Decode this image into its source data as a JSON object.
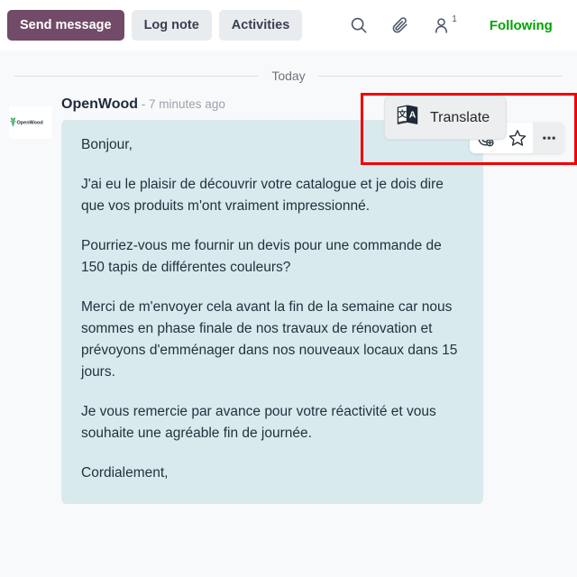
{
  "toolbar": {
    "send_message_label": "Send message",
    "log_note_label": "Log note",
    "activities_label": "Activities",
    "search_icon": "search-icon",
    "attachment_icon": "paperclip-icon",
    "followers_icon": "user-icon",
    "followers_count": "1",
    "following_label": "Following",
    "following_color": "#00a400",
    "send_button_color": "#714b67"
  },
  "thread": {
    "date_separator": "Today",
    "message": {
      "author": "OpenWood",
      "author_separator": " - ",
      "timestamp": "7 minutes ago",
      "avatar_alt": "OpenWood",
      "bubble_color": "#d9eaef",
      "paragraphs": [
        "Bonjour,",
        "J'ai eu le plaisir de découvrir votre catalogue et je dois dire que vos produits m'ont vraiment impressionné.",
        "Pourriez-vous me fournir un devis pour une commande de 150 tapis de différentes couleurs?",
        "Merci de m'envoyer cela avant la fin de la semaine car nous sommes en phase finale de nos travaux de rénovation et prévoyons d'emménager dans nos nouveaux locaux dans 15 jours.",
        "Je vous remercie par avance pour votre réactivité et vous souhaite une agréable fin de journée.",
        "Cordialement,"
      ]
    },
    "actions": {
      "add_reaction_icon": "add-reaction-icon",
      "toggle_star_icon": "star-icon",
      "expand_icon": "ellipsis-icon"
    }
  },
  "tooltip": {
    "translate_label": "Translate",
    "translate_icon": "translate-icon"
  },
  "annotation": {
    "highlight_color": "#f00000"
  }
}
